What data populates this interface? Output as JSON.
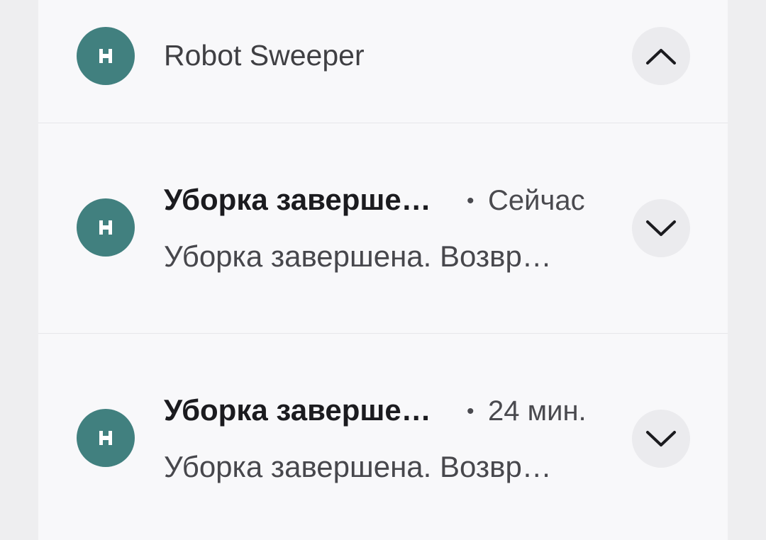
{
  "header": {
    "app_name": "Robot Sweeper",
    "app_icon": "robot-sweeper-app-icon",
    "toggle_icon": "chevron-up-icon"
  },
  "notifications": [
    {
      "title": "Уборка заверше…",
      "separator": "•",
      "time": "Сейчас",
      "body": "Уборка завершена. Возвр…",
      "toggle_icon": "chevron-down-icon"
    },
    {
      "title": "Уборка заверше…",
      "separator": "•",
      "time": "24 мин.",
      "body": "Уборка завершена. Возвр…",
      "toggle_icon": "chevron-down-icon"
    }
  ],
  "colors": {
    "app_icon_bg": "#41807f",
    "panel_bg": "#f8f8fa",
    "page_bg": "#eeeef0"
  }
}
